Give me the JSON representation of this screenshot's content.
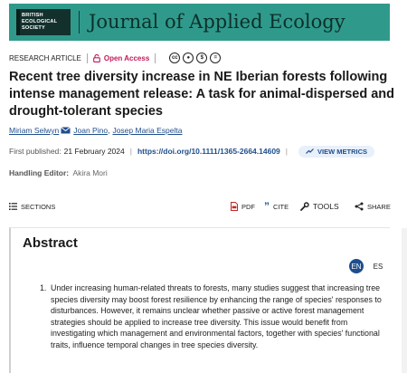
{
  "header": {
    "society_lines": [
      "BRITISH",
      "ECOLOGICAL",
      "SOCIETY"
    ],
    "journal_title": "Journal of Applied Ecology",
    "banner_color": "#2f9a8b"
  },
  "meta": {
    "article_type": "RESEARCH ARTICLE",
    "open_access": "Open Access",
    "license_icons": [
      "creative-commons-icon",
      "attribution-icon",
      "noncommercial-icon",
      "noderivatives-icon"
    ]
  },
  "article": {
    "title": "Recent tree diversity increase in NE Iberian forests following intense management release: A task for animal-dispersed and drought-tolerant species",
    "authors": [
      {
        "name": "Miriam Selwyn",
        "suffix": ""
      },
      {
        "name": "Joan Pino",
        "suffix": ","
      },
      {
        "name": "Josep Maria Espelta",
        "suffix": ""
      }
    ],
    "first_published_label": "First published:",
    "first_published_date": "21 February 2024",
    "doi": "https://doi.org/10.1111/1365-2664.14609",
    "metrics_label": "VIEW METRICS",
    "editor_label": "Handling Editor:",
    "editor_name": "Akira Mori"
  },
  "toolbar": {
    "sections": "SECTIONS",
    "pdf": "PDF",
    "cite": "CITE",
    "tools": "TOOLS",
    "share": "SHARE"
  },
  "abstract": {
    "heading": "Abstract",
    "lang_en": "EN",
    "lang_es": "ES",
    "item_number": "1.",
    "item_text": "Under increasing human-related threats to forests, many studies suggest that increasing tree species diversity may boost forest resilience by enhancing the range of species' responses to disturbances. However, it remains unclear whether passive or active forest management strategies should be applied to increase tree diversity. This issue would benefit from investigating which management and environmental factors, together with species' functional traits, influence temporal changes in tree species diversity."
  },
  "colors": {
    "accent_link": "#1f4e8c",
    "open_access": "#c2185b"
  }
}
